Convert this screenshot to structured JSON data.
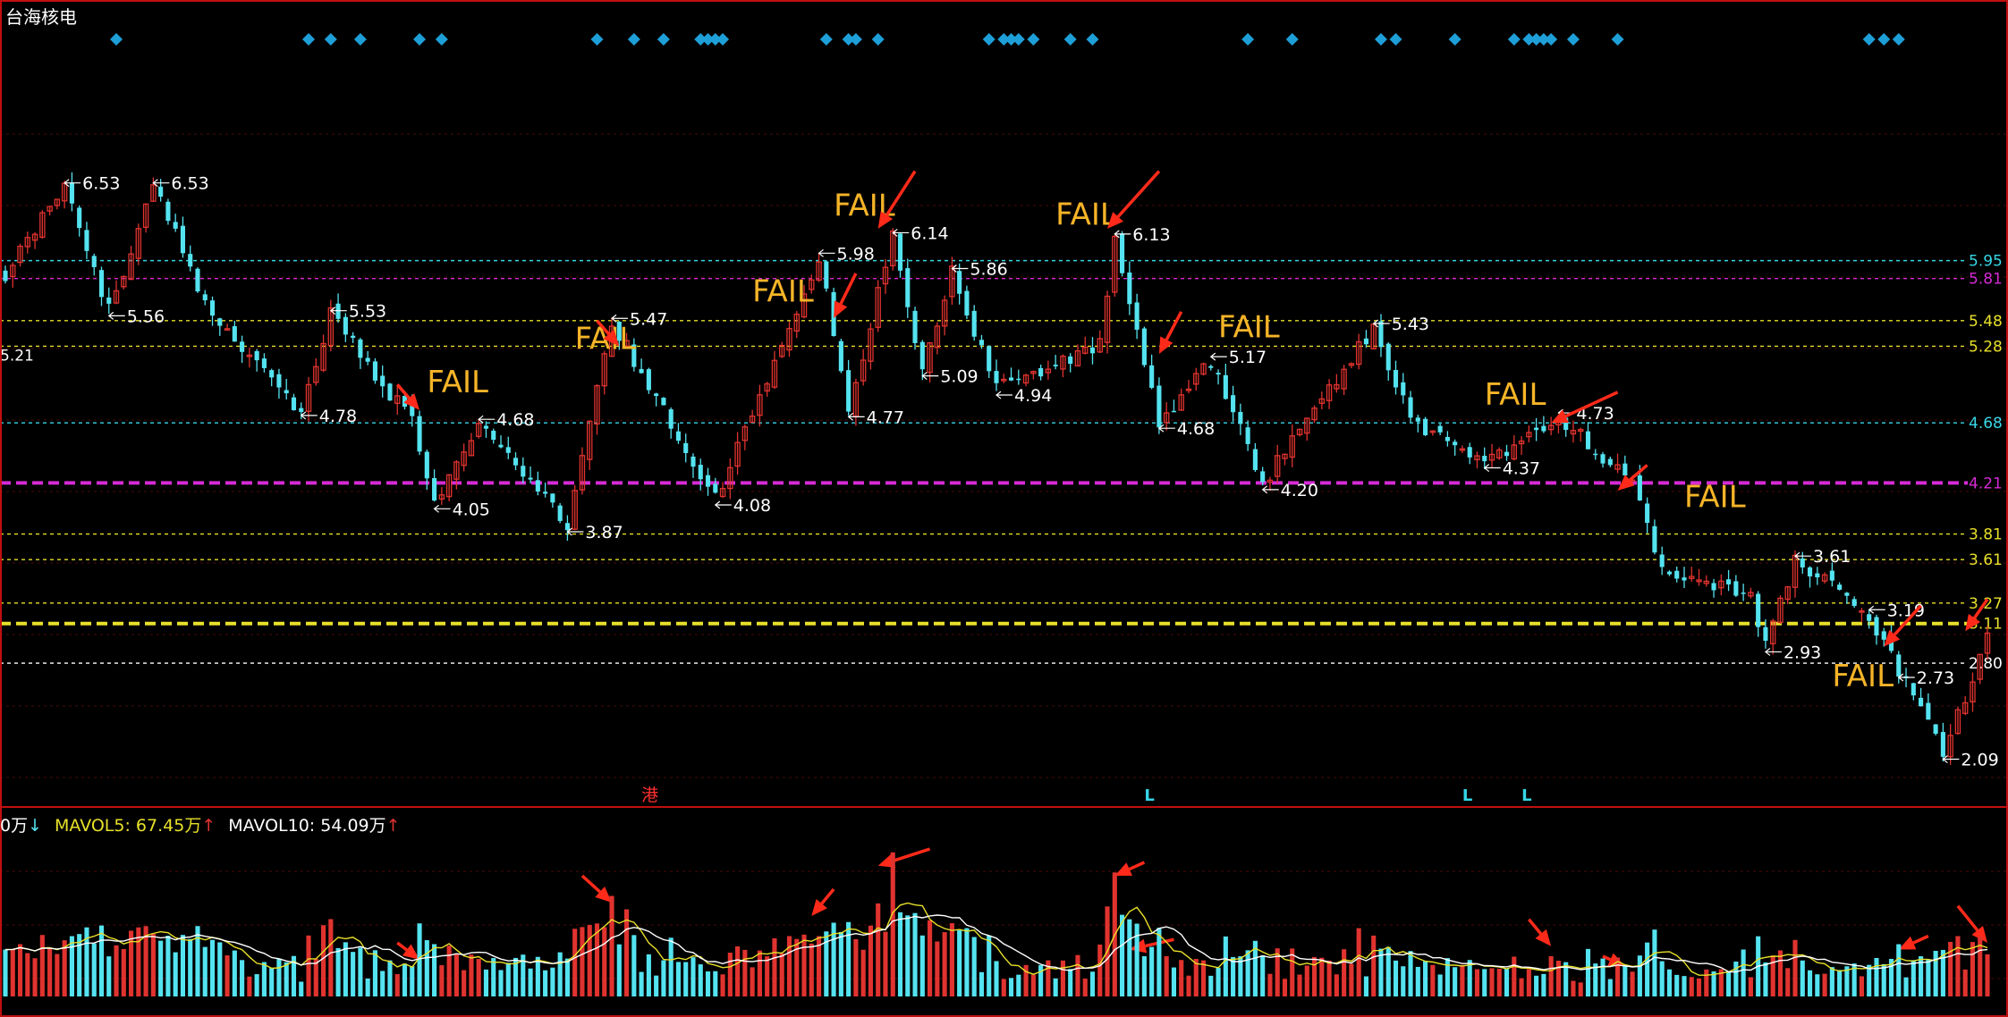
{
  "title": "台海核电",
  "event_marker": "港",
  "colors": {
    "up": "#e0332f",
    "down": "#54e3f0",
    "ma5": "#e8e02a",
    "ma10": "#ffffff",
    "fail": "#f5b428",
    "arrow": "#ff2a1a",
    "diamond": "#1e9fd8",
    "border": "#c01010"
  },
  "volume_legend": {
    "vol_text": "0万",
    "vol_arrow": "↓",
    "ma5_text": "MAVOL5: 67.45万",
    "ma5_arrow": "↑",
    "ma10_text": "MAVOL10: 54.09万",
    "ma10_arrow": "↑"
  },
  "chart_data": {
    "type": "candlestick",
    "title": "台海核电",
    "price_ylim": [
      1.8,
      7.5
    ],
    "volume_ylim": [
      0,
      220
    ],
    "volume_unit": "万",
    "x_index_range": [
      0,
      268
    ],
    "h_levels": [
      {
        "value": 5.95,
        "label": "5.95",
        "color": "#36d6e6",
        "style": "dotted"
      },
      {
        "value": 5.81,
        "label": "5.81",
        "color": "#d52bd5",
        "style": "dotted"
      },
      {
        "value": 5.48,
        "label": "5.48",
        "color": "#e8e02a",
        "style": "dotted"
      },
      {
        "value": 5.28,
        "label": "5.28",
        "color": "#e8e02a",
        "style": "dotted"
      },
      {
        "value": 4.68,
        "label": "4.68",
        "color": "#36d6e6",
        "style": "dotted"
      },
      {
        "value": 4.21,
        "label": "4.21",
        "color": "#d52bd5",
        "style": "dashed-thick"
      },
      {
        "value": 3.81,
        "label": "3.81",
        "color": "#e8e02a",
        "style": "dotted"
      },
      {
        "value": 3.61,
        "label": "3.61",
        "color": "#e8e02a",
        "style": "dotted"
      },
      {
        "value": 3.27,
        "label": "3.27",
        "color": "#e8e02a",
        "style": "dotted"
      },
      {
        "value": 3.11,
        "label": "3.11",
        "color": "#e8e02a",
        "style": "dashed-thick"
      },
      {
        "value": 2.8,
        "label": "2.80",
        "color": "#ffffff",
        "style": "dotted"
      }
    ],
    "left_edge_label": {
      "value": 5.21,
      "label": "5.21"
    },
    "anchors": [
      [
        0,
        5.85
      ],
      [
        8,
        6.53
      ],
      [
        14,
        5.56
      ],
      [
        20,
        6.53
      ],
      [
        28,
        5.5
      ],
      [
        31,
        5.3
      ],
      [
        40,
        4.78
      ],
      [
        44,
        5.53
      ],
      [
        55,
        4.68
      ],
      [
        58,
        4.05
      ],
      [
        64,
        4.68
      ],
      [
        76,
        3.87
      ],
      [
        82,
        5.47
      ],
      [
        96,
        4.08
      ],
      [
        110,
        5.98
      ],
      [
        114,
        4.77
      ],
      [
        120,
        6.14
      ],
      [
        124,
        5.09
      ],
      [
        128,
        5.86
      ],
      [
        134,
        4.94
      ],
      [
        148,
        5.3
      ],
      [
        150,
        6.13
      ],
      [
        156,
        4.68
      ],
      [
        163,
        5.17
      ],
      [
        170,
        4.2
      ],
      [
        185,
        5.43
      ],
      [
        190,
        4.7
      ],
      [
        200,
        4.37
      ],
      [
        210,
        4.73
      ],
      [
        220,
        4.21
      ],
      [
        224,
        3.5
      ],
      [
        236,
        3.35
      ],
      [
        242,
        3.61
      ],
      [
        238,
        2.93
      ],
      [
        252,
        3.19
      ],
      [
        256,
        2.73
      ],
      [
        262,
        2.09
      ],
      [
        268,
        3.0
      ]
    ],
    "price_labels": [
      {
        "i": 8,
        "v": 6.53,
        "text": "6.53",
        "pos": "above"
      },
      {
        "i": 20,
        "v": 6.53,
        "text": "6.53",
        "pos": "above"
      },
      {
        "i": 14,
        "v": 5.56,
        "text": "5.56",
        "pos": "below"
      },
      {
        "i": 44,
        "v": 5.53,
        "text": "5.53",
        "pos": "above"
      },
      {
        "i": 40,
        "v": 4.78,
        "text": "4.78",
        "pos": "below"
      },
      {
        "i": 64,
        "v": 4.68,
        "text": "4.68",
        "pos": "above"
      },
      {
        "i": 58,
        "v": 4.05,
        "text": "4.05",
        "pos": "below"
      },
      {
        "i": 76,
        "v": 3.87,
        "text": "3.87",
        "pos": "below"
      },
      {
        "i": 82,
        "v": 5.47,
        "text": "5.47",
        "pos": "above"
      },
      {
        "i": 96,
        "v": 4.08,
        "text": "4.08",
        "pos": "below"
      },
      {
        "i": 110,
        "v": 5.98,
        "text": "5.98",
        "pos": "above"
      },
      {
        "i": 114,
        "v": 4.77,
        "text": "4.77",
        "pos": "below"
      },
      {
        "i": 120,
        "v": 6.14,
        "text": "6.14",
        "pos": "above"
      },
      {
        "i": 124,
        "v": 5.09,
        "text": "5.09",
        "pos": "below"
      },
      {
        "i": 128,
        "v": 5.86,
        "text": "5.86",
        "pos": "above"
      },
      {
        "i": 134,
        "v": 4.94,
        "text": "4.94",
        "pos": "below"
      },
      {
        "i": 150,
        "v": 6.13,
        "text": "6.13",
        "pos": "above"
      },
      {
        "i": 163,
        "v": 5.17,
        "text": "5.17",
        "pos": "above"
      },
      {
        "i": 156,
        "v": 4.68,
        "text": "4.68",
        "pos": "below"
      },
      {
        "i": 170,
        "v": 4.2,
        "text": "4.20",
        "pos": "below"
      },
      {
        "i": 185,
        "v": 5.43,
        "text": "5.43",
        "pos": "above"
      },
      {
        "i": 200,
        "v": 4.37,
        "text": "4.37",
        "pos": "below"
      },
      {
        "i": 210,
        "v": 4.73,
        "text": "4.73",
        "pos": "above"
      },
      {
        "i": 242,
        "v": 3.61,
        "text": "3.61",
        "pos": "above"
      },
      {
        "i": 238,
        "v": 2.93,
        "text": "2.93",
        "pos": "below"
      },
      {
        "i": 252,
        "v": 3.19,
        "text": "3.19",
        "pos": "above"
      },
      {
        "i": 256,
        "v": 2.73,
        "text": "2.73",
        "pos": "below"
      },
      {
        "i": 262,
        "v": 2.09,
        "text": "2.09",
        "pos": "below"
      }
    ],
    "fail_labels": [
      {
        "text": "FAIL",
        "i": 57,
        "v": 4.92
      },
      {
        "text": "FAIL",
        "i": 77,
        "v": 5.26
      },
      {
        "text": "FAIL",
        "i": 101,
        "v": 5.63
      },
      {
        "text": "FAIL",
        "i": 112,
        "v": 6.3
      },
      {
        "text": "FAIL",
        "i": 142,
        "v": 6.23
      },
      {
        "text": "FAIL",
        "i": 164,
        "v": 5.35
      },
      {
        "text": "FAIL",
        "i": 200,
        "v": 4.82
      },
      {
        "text": "FAIL",
        "i": 227,
        "v": 4.02
      },
      {
        "text": "FAIL",
        "i": 247,
        "v": 2.62
      }
    ],
    "price_arrows": [
      [
        53,
        4.98,
        56,
        4.78
      ],
      [
        80,
        5.48,
        83,
        5.28
      ],
      [
        115,
        5.85,
        112,
        5.5
      ],
      [
        123,
        6.65,
        118,
        6.2
      ],
      [
        156,
        6.65,
        149,
        6.2
      ],
      [
        159,
        5.55,
        156,
        5.22
      ],
      [
        218,
        4.92,
        209,
        4.68
      ],
      [
        222,
        4.35,
        218,
        4.15
      ],
      [
        259,
        3.25,
        254,
        2.93
      ],
      [
        268,
        3.3,
        265,
        3.05
      ]
    ],
    "volume_arrows": [
      [
        78,
        180,
        82,
        140
      ],
      [
        53,
        80,
        56,
        55
      ],
      [
        112,
        160,
        109,
        120
      ],
      [
        125,
        220,
        118,
        195
      ],
      [
        154,
        200,
        150,
        180
      ],
      [
        158,
        85,
        152,
        70
      ],
      [
        206,
        115,
        209,
        75
      ],
      [
        216,
        60,
        219,
        45
      ],
      [
        260,
        90,
        256,
        70
      ],
      [
        264,
        135,
        268,
        80
      ]
    ],
    "diamond_indices": [
      15,
      41,
      44,
      48,
      56,
      59,
      80,
      85,
      89,
      94,
      95,
      96,
      97,
      111,
      114,
      115,
      118,
      133,
      135,
      136,
      137,
      139,
      144,
      147,
      168,
      174,
      186,
      188,
      196,
      204,
      206,
      207,
      208,
      209,
      212,
      218,
      252,
      254,
      256
    ],
    "l_markers": [
      154,
      197,
      205
    ],
    "event_marker_index": 86
  }
}
